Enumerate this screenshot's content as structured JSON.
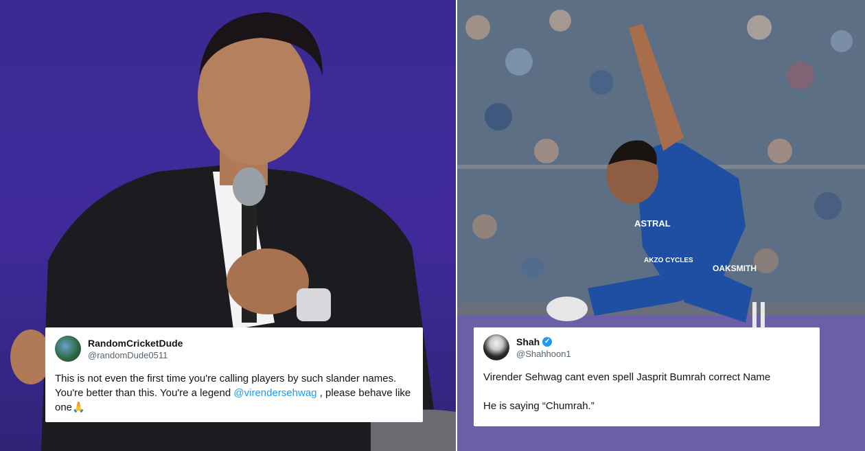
{
  "tweets": [
    {
      "display_name": "RandomCricketDude",
      "handle": "@randomDude0511",
      "text_before": "This is not even the first time you're calling players by such slander names. You're better than this. You're a legend ",
      "mention": "@virendersehwag",
      "text_after": " , please behave like one🙏"
    },
    {
      "display_name": "Shah",
      "handle": "@Shahhoon1",
      "paragraph_1": "Virender Sehwag cant even spell Jasprit Bumrah correct Name",
      "paragraph_2": "He is saying “Chumrah.”"
    }
  ],
  "photo_text": {
    "jersey_sponsor_1": "ASTRAL",
    "jersey_sponsor_2": "OAKSMITH",
    "jersey_sponsor_3": "AKZO CYCLES"
  },
  "icons": {
    "left_avatar": "avatar-image",
    "right_avatar": "avatar-image",
    "verified": "verified-badge-icon"
  },
  "colors": {
    "mention": "#1d9bf0",
    "verified": "#1d9bf0",
    "left_background": "#3b2a92"
  }
}
